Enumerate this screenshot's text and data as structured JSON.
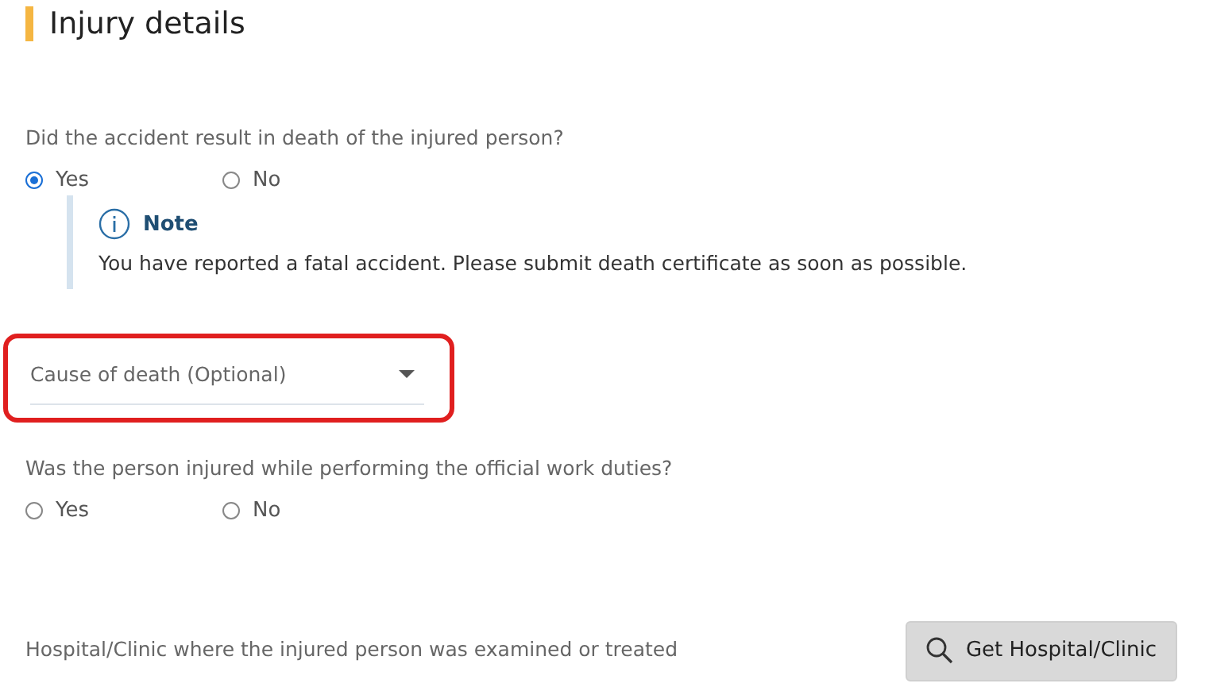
{
  "section": {
    "title": "Injury details"
  },
  "questions": [
    {
      "text": "Did the accident result in death of the injured person?",
      "options": [
        {
          "label": "Yes",
          "selected": true
        },
        {
          "label": "No",
          "selected": false
        }
      ]
    },
    {
      "text": "Was the person injured while performing the official work duties?",
      "options": [
        {
          "label": "Yes",
          "selected": false
        },
        {
          "label": "No",
          "selected": false
        }
      ]
    }
  ],
  "note": {
    "title": "Note",
    "text": "You have reported a fatal accident. Please submit death certificate as soon as possible."
  },
  "dropdown": {
    "placeholder": "Cause of death (Optional)",
    "highlighted": true
  },
  "hospital": {
    "label": "Hospital/Clinic where the injured person was examined or treated",
    "button": "Get Hospital/Clinic"
  }
}
